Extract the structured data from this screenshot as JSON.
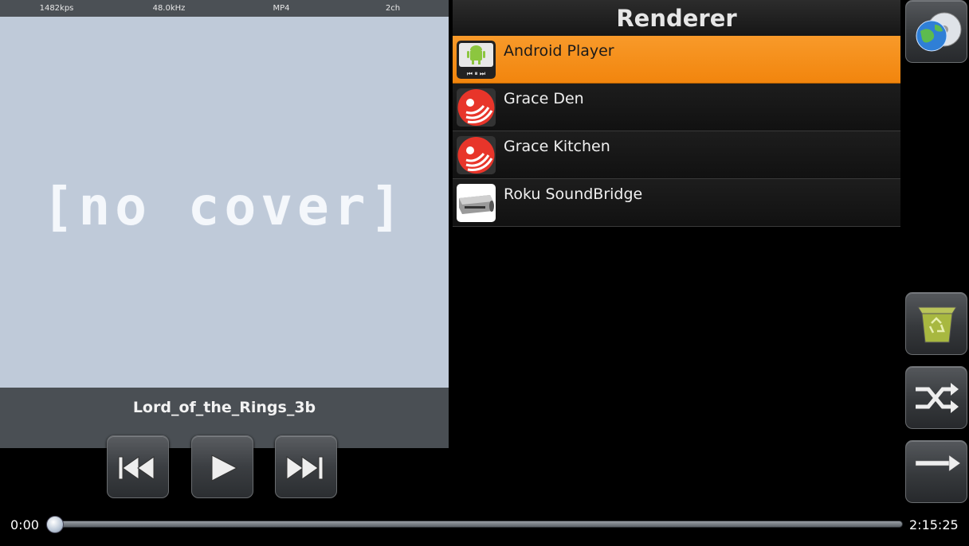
{
  "player": {
    "stats": {
      "bitrate": "1482kps",
      "sample_rate": "48.0kHz",
      "format": "MP4",
      "channels": "2ch"
    },
    "cover_placeholder": "[no cover]",
    "track_title": "Lord_of_the_Rings_3b",
    "controls": {
      "previous_icon": "skip-previous-icon",
      "play_icon": "play-icon",
      "next_icon": "skip-next-icon"
    },
    "progress": {
      "current_time": "0:00",
      "total_time": "2:15:25",
      "fraction": 0.0
    }
  },
  "renderer": {
    "title": "Renderer",
    "items": [
      {
        "label": "Android Player",
        "icon": "android-player-icon",
        "selected": true
      },
      {
        "label": "Grace Den",
        "icon": "grace-wireless-icon",
        "selected": false
      },
      {
        "label": "Grace Kitchen",
        "icon": "grace-wireless-icon",
        "selected": false
      },
      {
        "label": "Roku SoundBridge",
        "icon": "roku-soundbridge-icon",
        "selected": false
      }
    ]
  },
  "side_buttons": {
    "network_icon": "globe-disc-icon",
    "clear_icon": "recycle-bin-icon",
    "shuffle_icon": "shuffle-icon",
    "repeat_icon": "arrow-right-icon"
  },
  "colors": {
    "accent_selected": "#f28a16",
    "cover_bg": "#bfcad9",
    "panel_bg": "#4a4f54"
  }
}
